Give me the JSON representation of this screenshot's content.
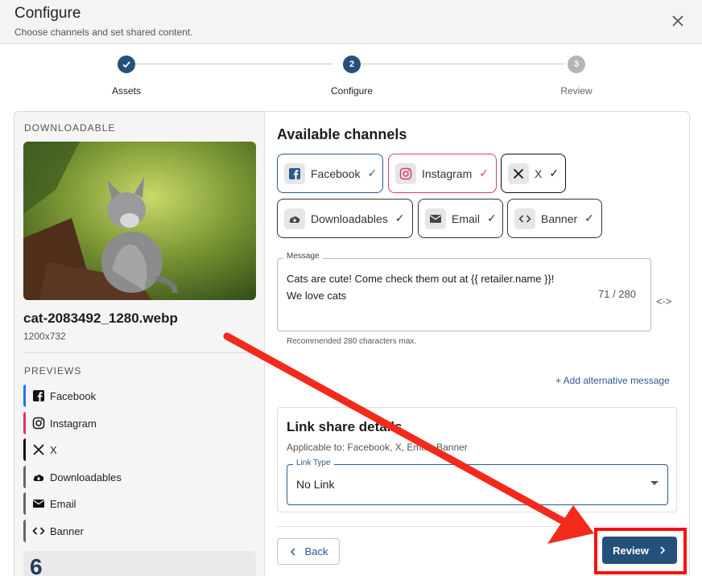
{
  "dialog": {
    "title": "Configure",
    "subtitle": "Choose channels and set shared content."
  },
  "stepper": [
    {
      "number": "✓",
      "label": "Assets",
      "state": "complete"
    },
    {
      "number": "2",
      "label": "Configure",
      "state": "active"
    },
    {
      "number": "3",
      "label": "Review",
      "state": "pending"
    }
  ],
  "asset": {
    "section_label": "DOWNLOADABLE",
    "filename": "cat-2083492_1280.webp",
    "dimensions": "1200x732",
    "previews_label": "PREVIEWS",
    "previews": [
      {
        "label": "Facebook",
        "icon": "facebook-icon",
        "color": "#1877f2"
      },
      {
        "label": "Instagram",
        "icon": "instagram-icon",
        "color": "#e1306c"
      },
      {
        "label": "X",
        "icon": "x-icon",
        "color": "#111111"
      },
      {
        "label": "Downloadables",
        "icon": "cloud-download-icon",
        "color": "#555555"
      },
      {
        "label": "Email",
        "icon": "mail-icon",
        "color": "#555555"
      },
      {
        "label": "Banner",
        "icon": "code-icon",
        "color": "#555555"
      }
    ],
    "stat_partial": "6"
  },
  "channels": {
    "heading": "Available channels",
    "items": [
      {
        "label": "Facebook",
        "icon": "facebook-icon",
        "check": "✓",
        "border": "#2c5a8c",
        "check_color": "#2c5a8c"
      },
      {
        "label": "Instagram",
        "icon": "instagram-icon",
        "check": "✓",
        "border": "#d63a6f",
        "check_color": "#d63a6f"
      },
      {
        "label": "X",
        "icon": "x-icon",
        "check": "✓",
        "border": "#111111",
        "check_color": "#111111"
      },
      {
        "label": "Downloadables",
        "icon": "cloud-download-icon",
        "check": "✓",
        "border": "#333333",
        "check_color": "#333333"
      },
      {
        "label": "Email",
        "icon": "mail-icon",
        "check": "✓",
        "border": "#333333",
        "check_color": "#333333"
      },
      {
        "label": "Banner",
        "icon": "code-icon",
        "check": "✓",
        "border": "#333333",
        "check_color": "#333333"
      }
    ]
  },
  "message": {
    "legend": "Message",
    "text": "Cats are cute! Come check them out at {{ retailer.name }}!\nWe love cats",
    "counter": "71 / 280",
    "hint": "Recommended 280 characters max.",
    "variable_icon": "<·>",
    "add_alternative": "+ Add alternative message"
  },
  "link_share": {
    "heading": "Link share details",
    "applicable": "Applicable to: Facebook, X, Email, Banner",
    "select_legend": "Link Type",
    "select_value": "No Link"
  },
  "footer": {
    "back_label": "Back",
    "review_label": "Review"
  },
  "colors": {
    "primary": "#24507c",
    "annotation_red": "#ff0e0e"
  }
}
